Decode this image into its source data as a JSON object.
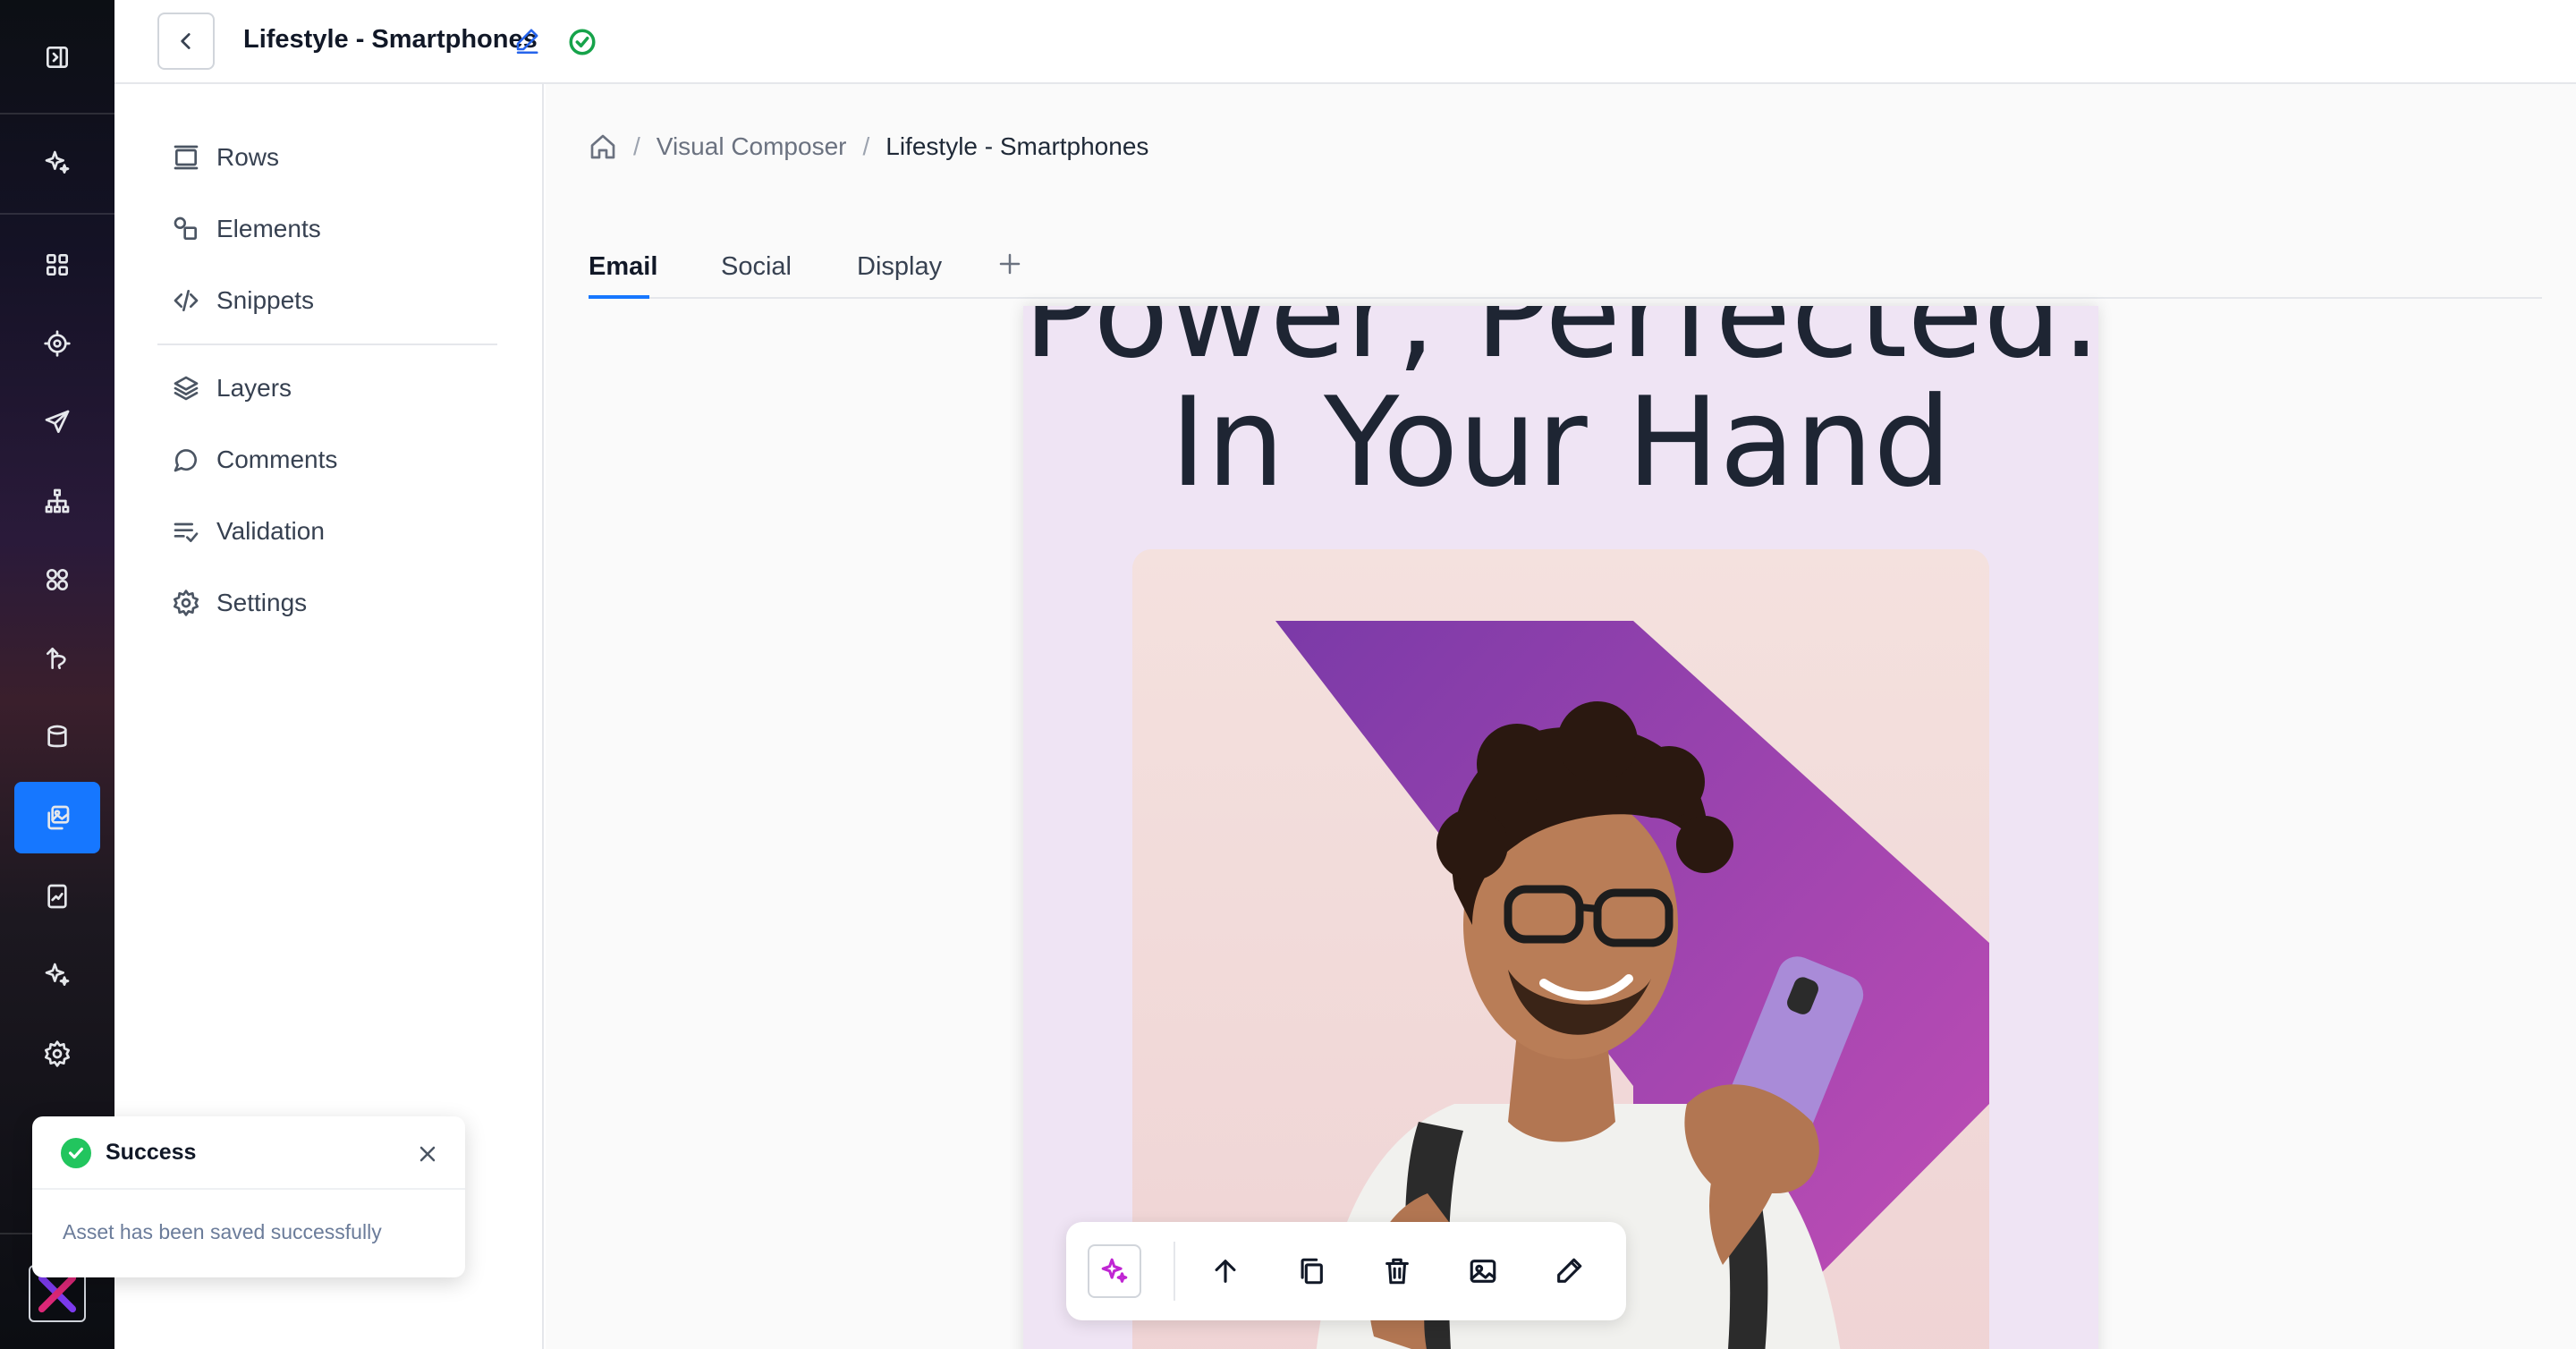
{
  "header": {
    "title": "Lifestyle - Smartphones",
    "back_icon": "chevron-left-icon",
    "edit_icon": "pencil-icon",
    "status_icon": "check-circle-icon"
  },
  "rail": {
    "items": [
      {
        "name": "collapse-sidebar",
        "icon": "panel-collapse-icon"
      },
      {
        "name": "ai-assistant",
        "icon": "sparkle-icon"
      },
      {
        "name": "dashboard",
        "icon": "grid-icon"
      },
      {
        "name": "targeting",
        "icon": "target-icon"
      },
      {
        "name": "campaigns",
        "icon": "send-icon"
      },
      {
        "name": "hierarchy",
        "icon": "org-chart-icon"
      },
      {
        "name": "components",
        "icon": "shapes-icon"
      },
      {
        "name": "journeys",
        "icon": "route-icon"
      },
      {
        "name": "database",
        "icon": "database-icon"
      },
      {
        "name": "assets",
        "icon": "copy-image-icon",
        "active": true
      },
      {
        "name": "reports",
        "icon": "chart-file-icon"
      },
      {
        "name": "ai-tools",
        "icon": "sparkle-icon"
      },
      {
        "name": "settings",
        "icon": "gear-icon"
      }
    ],
    "active_color": "#1677ff"
  },
  "sidebar": {
    "items": [
      {
        "label": "Rows",
        "icon": "rows-icon"
      },
      {
        "label": "Elements",
        "icon": "elements-icon"
      },
      {
        "label": "Snippets",
        "icon": "code-icon"
      },
      {
        "label": "Layers",
        "icon": "layers-icon"
      },
      {
        "label": "Comments",
        "icon": "comment-icon"
      },
      {
        "label": "Validation",
        "icon": "list-check-icon"
      },
      {
        "label": "Settings",
        "icon": "gear-icon"
      }
    ]
  },
  "breadcrumb": {
    "home_icon": "home-icon",
    "separator": "/",
    "items": [
      "Visual Composer",
      "Lifestyle - Smartphones"
    ]
  },
  "tabs": [
    {
      "label": "Email",
      "active": true
    },
    {
      "label": "Social"
    },
    {
      "label": "Display"
    }
  ],
  "add_tab_icon": "plus-icon",
  "canvas": {
    "headline_line1": "Power, Perfected.",
    "headline_line2": "In Your Hand",
    "hero_image": "man-with-smartphone-photo",
    "background_color": "#efe4f4"
  },
  "element_toolbar": {
    "buttons": [
      "ai-sparkle-icon",
      "arrow-up-icon",
      "duplicate-icon",
      "trash-icon",
      "image-icon",
      "pencil-icon"
    ]
  },
  "toast": {
    "title": "Success",
    "message": "Asset has been saved successfully",
    "icon": "check-circle-icon",
    "close_icon": "close-icon"
  }
}
